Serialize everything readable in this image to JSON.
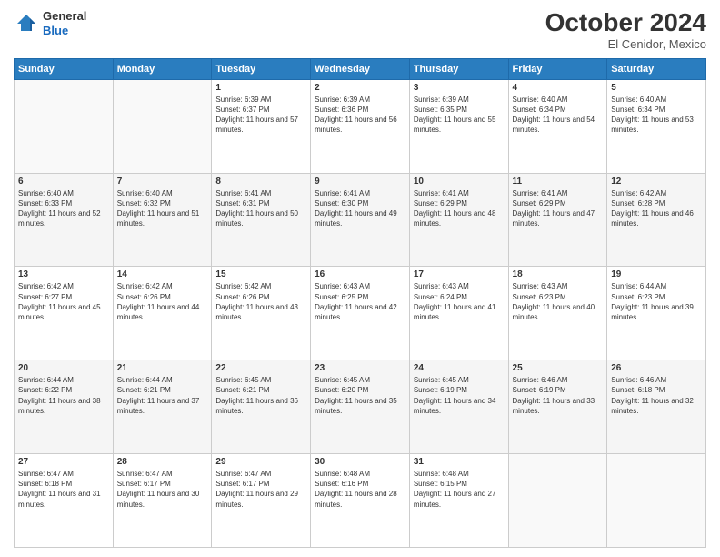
{
  "header": {
    "logo": {
      "general": "General",
      "blue": "Blue"
    },
    "title": "October 2024",
    "location": "El Cenidor, Mexico"
  },
  "weekdays": [
    "Sunday",
    "Monday",
    "Tuesday",
    "Wednesday",
    "Thursday",
    "Friday",
    "Saturday"
  ],
  "weeks": [
    [
      {
        "day": "",
        "sunrise": "",
        "sunset": "",
        "daylight": ""
      },
      {
        "day": "",
        "sunrise": "",
        "sunset": "",
        "daylight": ""
      },
      {
        "day": "1",
        "sunrise": "Sunrise: 6:39 AM",
        "sunset": "Sunset: 6:37 PM",
        "daylight": "Daylight: 11 hours and 57 minutes."
      },
      {
        "day": "2",
        "sunrise": "Sunrise: 6:39 AM",
        "sunset": "Sunset: 6:36 PM",
        "daylight": "Daylight: 11 hours and 56 minutes."
      },
      {
        "day": "3",
        "sunrise": "Sunrise: 6:39 AM",
        "sunset": "Sunset: 6:35 PM",
        "daylight": "Daylight: 11 hours and 55 minutes."
      },
      {
        "day": "4",
        "sunrise": "Sunrise: 6:40 AM",
        "sunset": "Sunset: 6:34 PM",
        "daylight": "Daylight: 11 hours and 54 minutes."
      },
      {
        "day": "5",
        "sunrise": "Sunrise: 6:40 AM",
        "sunset": "Sunset: 6:34 PM",
        "daylight": "Daylight: 11 hours and 53 minutes."
      }
    ],
    [
      {
        "day": "6",
        "sunrise": "Sunrise: 6:40 AM",
        "sunset": "Sunset: 6:33 PM",
        "daylight": "Daylight: 11 hours and 52 minutes."
      },
      {
        "day": "7",
        "sunrise": "Sunrise: 6:40 AM",
        "sunset": "Sunset: 6:32 PM",
        "daylight": "Daylight: 11 hours and 51 minutes."
      },
      {
        "day": "8",
        "sunrise": "Sunrise: 6:41 AM",
        "sunset": "Sunset: 6:31 PM",
        "daylight": "Daylight: 11 hours and 50 minutes."
      },
      {
        "day": "9",
        "sunrise": "Sunrise: 6:41 AM",
        "sunset": "Sunset: 6:30 PM",
        "daylight": "Daylight: 11 hours and 49 minutes."
      },
      {
        "day": "10",
        "sunrise": "Sunrise: 6:41 AM",
        "sunset": "Sunset: 6:29 PM",
        "daylight": "Daylight: 11 hours and 48 minutes."
      },
      {
        "day": "11",
        "sunrise": "Sunrise: 6:41 AM",
        "sunset": "Sunset: 6:29 PM",
        "daylight": "Daylight: 11 hours and 47 minutes."
      },
      {
        "day": "12",
        "sunrise": "Sunrise: 6:42 AM",
        "sunset": "Sunset: 6:28 PM",
        "daylight": "Daylight: 11 hours and 46 minutes."
      }
    ],
    [
      {
        "day": "13",
        "sunrise": "Sunrise: 6:42 AM",
        "sunset": "Sunset: 6:27 PM",
        "daylight": "Daylight: 11 hours and 45 minutes."
      },
      {
        "day": "14",
        "sunrise": "Sunrise: 6:42 AM",
        "sunset": "Sunset: 6:26 PM",
        "daylight": "Daylight: 11 hours and 44 minutes."
      },
      {
        "day": "15",
        "sunrise": "Sunrise: 6:42 AM",
        "sunset": "Sunset: 6:26 PM",
        "daylight": "Daylight: 11 hours and 43 minutes."
      },
      {
        "day": "16",
        "sunrise": "Sunrise: 6:43 AM",
        "sunset": "Sunset: 6:25 PM",
        "daylight": "Daylight: 11 hours and 42 minutes."
      },
      {
        "day": "17",
        "sunrise": "Sunrise: 6:43 AM",
        "sunset": "Sunset: 6:24 PM",
        "daylight": "Daylight: 11 hours and 41 minutes."
      },
      {
        "day": "18",
        "sunrise": "Sunrise: 6:43 AM",
        "sunset": "Sunset: 6:23 PM",
        "daylight": "Daylight: 11 hours and 40 minutes."
      },
      {
        "day": "19",
        "sunrise": "Sunrise: 6:44 AM",
        "sunset": "Sunset: 6:23 PM",
        "daylight": "Daylight: 11 hours and 39 minutes."
      }
    ],
    [
      {
        "day": "20",
        "sunrise": "Sunrise: 6:44 AM",
        "sunset": "Sunset: 6:22 PM",
        "daylight": "Daylight: 11 hours and 38 minutes."
      },
      {
        "day": "21",
        "sunrise": "Sunrise: 6:44 AM",
        "sunset": "Sunset: 6:21 PM",
        "daylight": "Daylight: 11 hours and 37 minutes."
      },
      {
        "day": "22",
        "sunrise": "Sunrise: 6:45 AM",
        "sunset": "Sunset: 6:21 PM",
        "daylight": "Daylight: 11 hours and 36 minutes."
      },
      {
        "day": "23",
        "sunrise": "Sunrise: 6:45 AM",
        "sunset": "Sunset: 6:20 PM",
        "daylight": "Daylight: 11 hours and 35 minutes."
      },
      {
        "day": "24",
        "sunrise": "Sunrise: 6:45 AM",
        "sunset": "Sunset: 6:19 PM",
        "daylight": "Daylight: 11 hours and 34 minutes."
      },
      {
        "day": "25",
        "sunrise": "Sunrise: 6:46 AM",
        "sunset": "Sunset: 6:19 PM",
        "daylight": "Daylight: 11 hours and 33 minutes."
      },
      {
        "day": "26",
        "sunrise": "Sunrise: 6:46 AM",
        "sunset": "Sunset: 6:18 PM",
        "daylight": "Daylight: 11 hours and 32 minutes."
      }
    ],
    [
      {
        "day": "27",
        "sunrise": "Sunrise: 6:47 AM",
        "sunset": "Sunset: 6:18 PM",
        "daylight": "Daylight: 11 hours and 31 minutes."
      },
      {
        "day": "28",
        "sunrise": "Sunrise: 6:47 AM",
        "sunset": "Sunset: 6:17 PM",
        "daylight": "Daylight: 11 hours and 30 minutes."
      },
      {
        "day": "29",
        "sunrise": "Sunrise: 6:47 AM",
        "sunset": "Sunset: 6:17 PM",
        "daylight": "Daylight: 11 hours and 29 minutes."
      },
      {
        "day": "30",
        "sunrise": "Sunrise: 6:48 AM",
        "sunset": "Sunset: 6:16 PM",
        "daylight": "Daylight: 11 hours and 28 minutes."
      },
      {
        "day": "31",
        "sunrise": "Sunrise: 6:48 AM",
        "sunset": "Sunset: 6:15 PM",
        "daylight": "Daylight: 11 hours and 27 minutes."
      },
      {
        "day": "",
        "sunrise": "",
        "sunset": "",
        "daylight": ""
      },
      {
        "day": "",
        "sunrise": "",
        "sunset": "",
        "daylight": ""
      }
    ]
  ]
}
